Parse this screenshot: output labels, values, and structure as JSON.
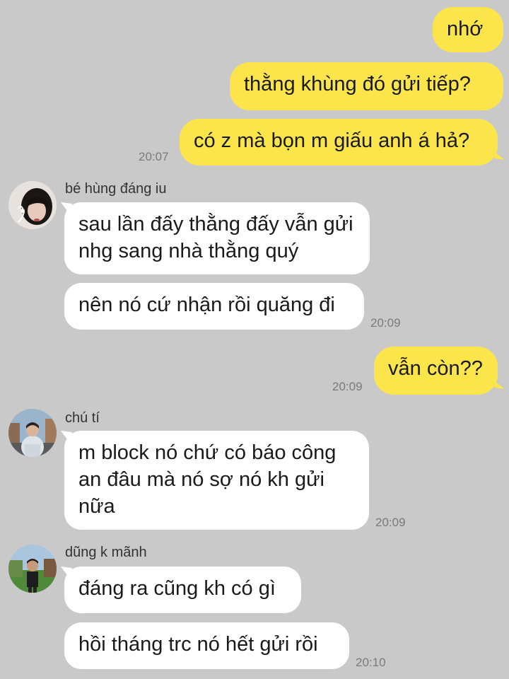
{
  "messages": {
    "out1": {
      "text": "nhớ"
    },
    "out2": {
      "text": "thằng khùng đó gửi tiếp?"
    },
    "out3": {
      "text": "có z mà bọn m giấu anh á hả?",
      "time": "20:07"
    },
    "group1": {
      "sender": "bé hùng đáng iu",
      "avatar": "avatar-girl-with-earphones",
      "msg1": "sau lần đấy thằng đấy vẫn gửi nhg sang nhà thằng quý",
      "msg2": "nên nó cứ nhận rồi quăng đi",
      "time": "20:09"
    },
    "out4": {
      "text": "vẫn còn??",
      "time": "20:09"
    },
    "group2": {
      "sender": "chú tí",
      "avatar": "avatar-boy-in-city",
      "msg1": "m block nó chứ có báo công an đâu mà nó sợ nó kh gửi nữa",
      "time": "20:09"
    },
    "group3": {
      "sender": "dũng k mãnh",
      "avatar": "avatar-boy-in-park",
      "msg1": "đáng ra cũng kh có gì",
      "msg2": "hồi tháng trc nó hết gửi rồi",
      "time": "20:10"
    }
  },
  "colors": {
    "background": "#c9c9c9",
    "outgoing_bubble": "#fbe54b",
    "incoming_bubble": "#ffffff",
    "timestamp": "#7a7a7a"
  }
}
